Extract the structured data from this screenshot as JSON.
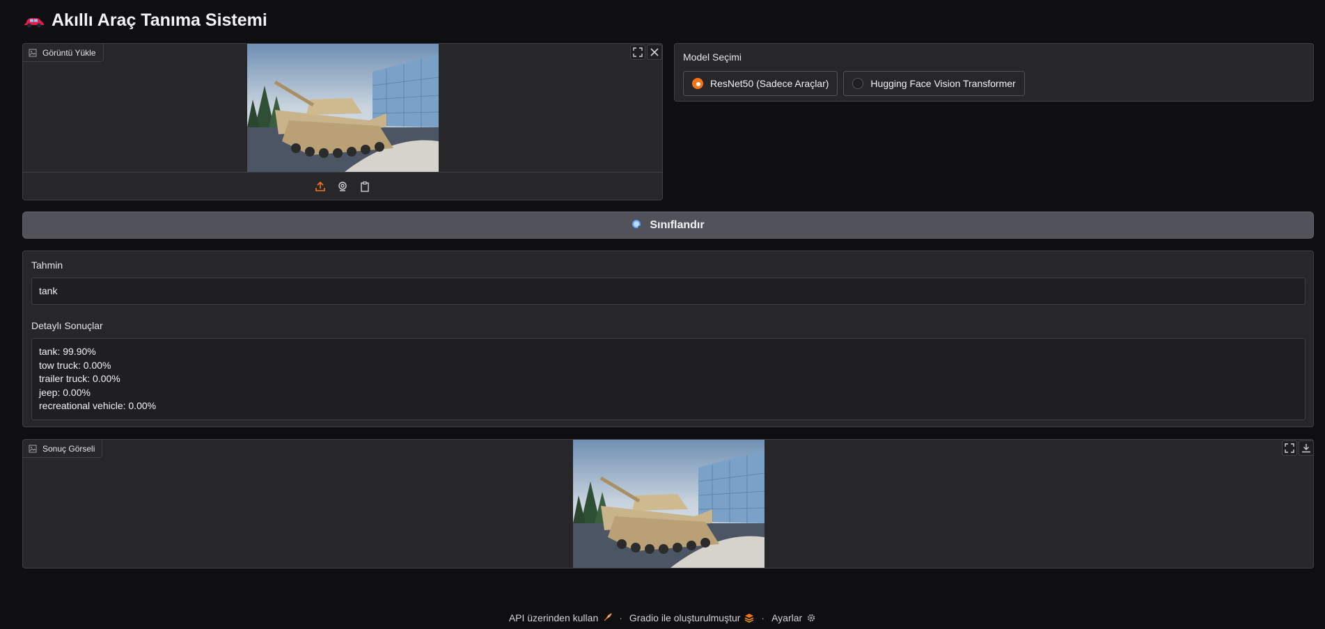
{
  "app": {
    "title": "Akıllı Araç Tanıma Sistemi"
  },
  "upload": {
    "label": "Görüntü Yükle"
  },
  "model": {
    "label": "Model Seçimi",
    "options": [
      {
        "label": "ResNet50 (Sadece Araçlar)",
        "selected": true
      },
      {
        "label": "Hugging Face Vision Transformer",
        "selected": false
      }
    ]
  },
  "classify": {
    "label": "Sınıflandır"
  },
  "prediction": {
    "label": "Tahmin",
    "value": "tank"
  },
  "details": {
    "label": "Detaylı Sonuçlar",
    "lines": [
      "tank: 99.90%",
      "tow truck: 0.00%",
      "trailer truck: 0.00%",
      "jeep: 0.00%",
      "recreational vehicle: 0.00%"
    ]
  },
  "result_image": {
    "label": "Sonuç Görseli"
  },
  "footer": {
    "api": "API üzerinden kullan",
    "built_with": "Gradio ile oluşturulmuştur",
    "settings": "Ayarlar",
    "separator": "·"
  },
  "colors": {
    "accent": "#f97316",
    "background": "#0f0f11",
    "panel": "#27272a"
  }
}
